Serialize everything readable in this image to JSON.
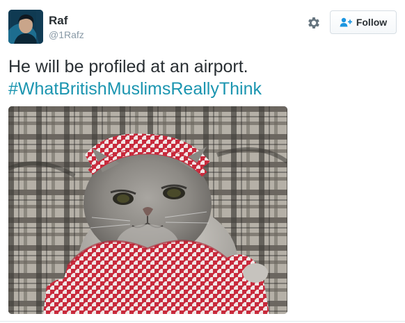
{
  "user": {
    "display_name": "Raf",
    "handle": "@1Rafz"
  },
  "actions": {
    "follow_label": "Follow"
  },
  "tweet": {
    "text": "He will be profiled at an airport.",
    "hashtag": "#WhatBritishMuslimsReallyThink"
  },
  "icons": {
    "settings": "gear-icon",
    "follow": "add-user-icon"
  },
  "colors": {
    "hashtag": "#1b95b0",
    "name": "#292f33",
    "handle": "#8899a6"
  }
}
